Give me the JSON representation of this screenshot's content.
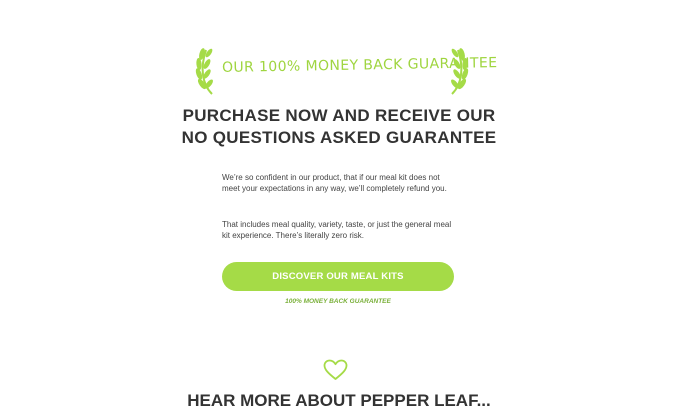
{
  "banner": {
    "text": "OUR 100% MONEY BACK GUARANTEE",
    "left_icon": "laurel-left-icon",
    "right_icon": "laurel-right-icon"
  },
  "headline": {
    "line1": "PURCHASE NOW AND RECEIVE OUR",
    "line2": "NO QUESTIONS ASKED GUARANTEE"
  },
  "body": {
    "paragraph1": "We’re so confident in our product, that if our meal kit does not meet your expectations in any way, we’ll completely refund you.",
    "paragraph2": "That includes meal quality, variety, taste, or just the general meal kit experience. There’s literally zero risk."
  },
  "cta": {
    "label": "DISCOVER OUR MEAL KITS",
    "subtext": "100% MONEY BACK GUARANTEE"
  },
  "section": {
    "icon": "heart-icon",
    "title": "HEAR MORE ABOUT PEPPER LEAF..."
  },
  "colors": {
    "accent_green": "#a5db47",
    "banner_green": "#9fd540",
    "subtext_green": "#7ab03a",
    "text_dark": "#333333"
  }
}
